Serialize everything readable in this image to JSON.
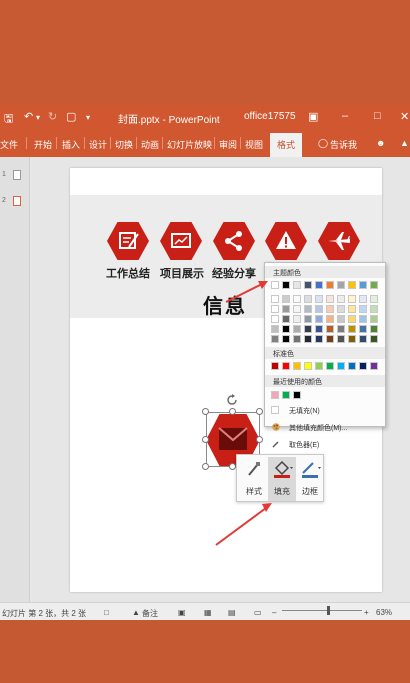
{
  "titlebar": {
    "file_title": "封面.pptx - PowerPoint",
    "account": "office17575",
    "save_icon": "save-icon",
    "undo_icon": "undo-icon",
    "redo_icon": "redo-icon"
  },
  "ribbon": {
    "tabs": [
      "文件",
      "开始",
      "插入",
      "设计",
      "切换",
      "动画",
      "幻灯片放映",
      "审阅",
      "视图",
      "格式"
    ],
    "active_tab": "格式",
    "tell_me": "告诉我"
  },
  "slide": {
    "hex_labels": [
      "工作总结",
      "项目展示",
      "经验分享"
    ],
    "info_title": "信息",
    "hex_color": "#c81f16"
  },
  "color_menu": {
    "theme_colors_label": "主题颜色",
    "standard_colors_label": "标准色",
    "recent_colors_label": "最近使用的颜色",
    "no_fill": "无填充(N)",
    "more_fill": "其他填充颜色(M)...",
    "eyedropper": "取色器(E)",
    "theme_top_row": [
      "#ffffff",
      "#000000",
      "#e7e6e6",
      "#44546a",
      "#4472c4",
      "#ed7d31",
      "#a5a5a5",
      "#ffc000",
      "#5b9bd5",
      "#70ad47"
    ],
    "standard_colors": [
      "#c00000",
      "#ff0000",
      "#ffc000",
      "#ffff00",
      "#92d050",
      "#00b050",
      "#00b0f0",
      "#0070c0",
      "#002060",
      "#7030a0"
    ],
    "recent_colors": [
      "#f4a7b9",
      "#00b050",
      "#000000"
    ]
  },
  "mini_toolbar": {
    "style_label": "样式",
    "fill_label": "填充",
    "outline_label": "边框"
  },
  "statusbar": {
    "slide_info": "幻灯片 第 2 张，共 2 张",
    "notes": "备注",
    "zoom": "63%"
  }
}
